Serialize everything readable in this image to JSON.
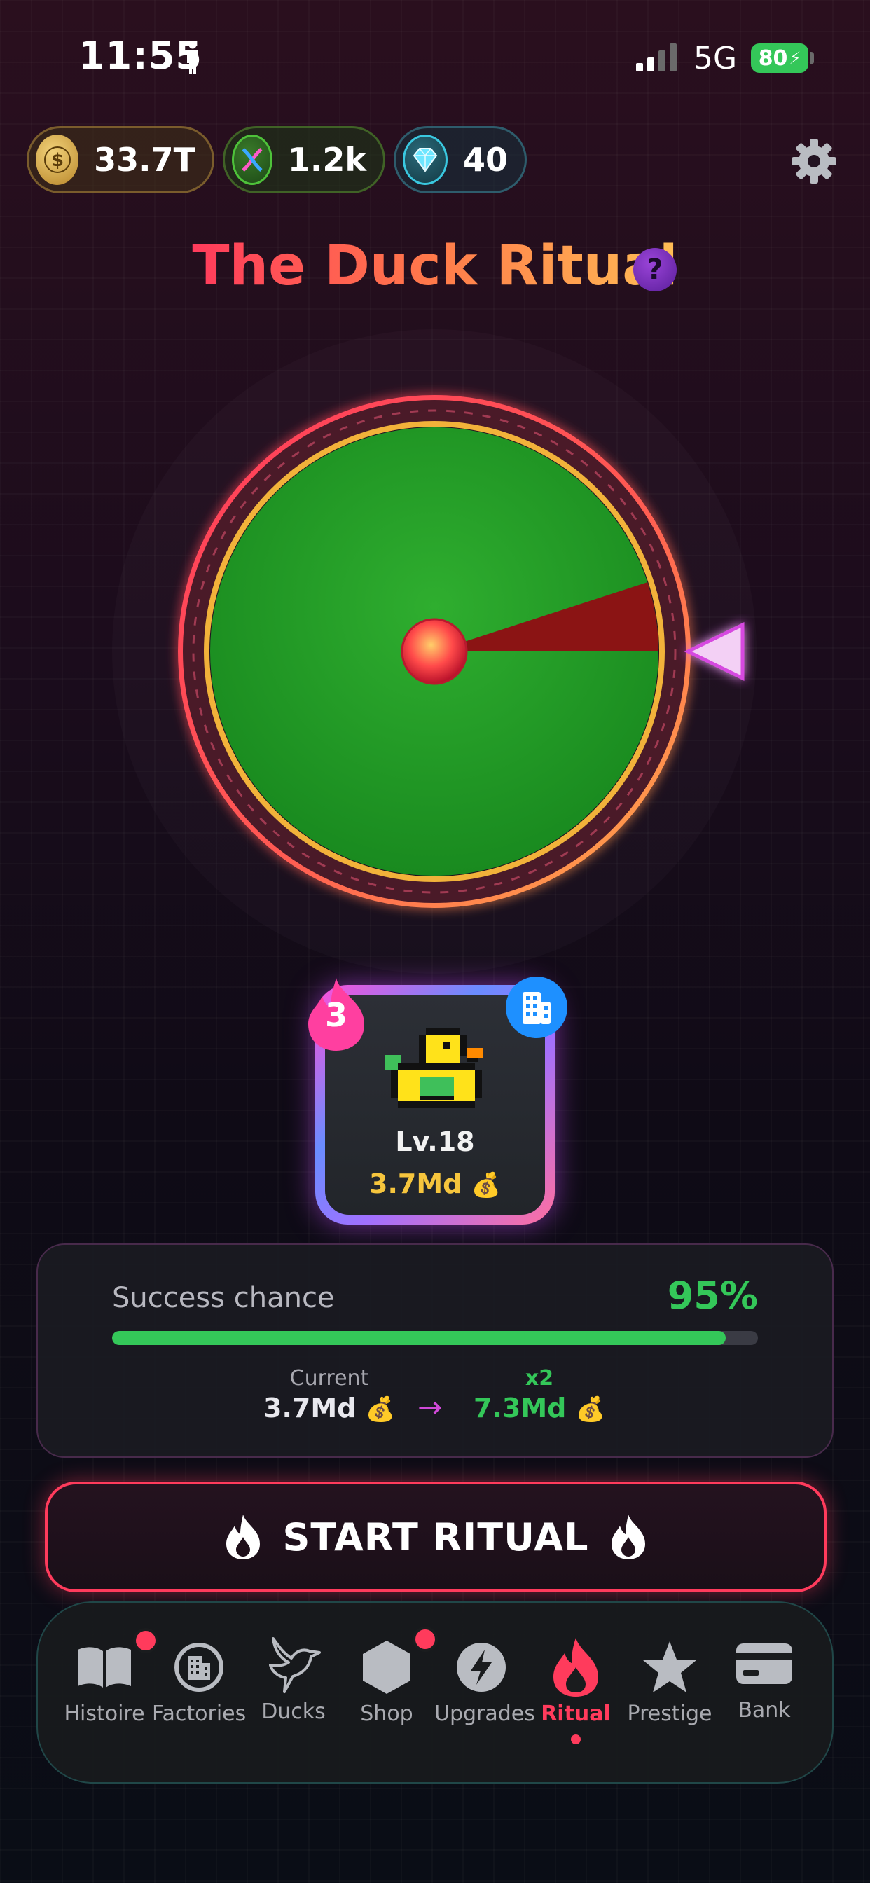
{
  "status_bar": {
    "time": "11:55",
    "network": "5G",
    "battery": "80"
  },
  "currencies": [
    {
      "name": "money",
      "value": "33.7T"
    },
    {
      "name": "dna",
      "value": "1.2k"
    },
    {
      "name": "gems",
      "value": "40"
    }
  ],
  "title": "The Duck Ritual",
  "help_icon": "?",
  "wheel": {
    "success_color": "#1f9a2a",
    "fail_color": "#8b1414",
    "fail_fraction": 0.05
  },
  "duck_card": {
    "streak": "3",
    "level": "Lv.18",
    "value": "3.7Md",
    "value_icon": "💰"
  },
  "success": {
    "label": "Success chance",
    "percent_text": "95%",
    "fraction": 0.95,
    "current_label": "Current",
    "current_value": "3.7Md",
    "multiplier": "x2",
    "new_value": "7.3Md",
    "money_icon": "💰",
    "arrow": "→"
  },
  "start_button": {
    "label": "START RITUAL"
  },
  "tabs": [
    {
      "id": "histoire",
      "label": "Histoire",
      "badge": true,
      "icon": "book-icon"
    },
    {
      "id": "factories",
      "label": "Factories",
      "badge": false,
      "icon": "factory-icon"
    },
    {
      "id": "ducks",
      "label": "Ducks",
      "badge": false,
      "icon": "bird-icon"
    },
    {
      "id": "shop",
      "label": "Shop",
      "badge": true,
      "icon": "hexagon-icon"
    },
    {
      "id": "upgrades",
      "label": "Upgrades",
      "badge": false,
      "icon": "bolt-icon"
    },
    {
      "id": "ritual",
      "label": "Ritual",
      "badge": false,
      "icon": "flame-icon",
      "active": true
    },
    {
      "id": "prestige",
      "label": "Prestige",
      "badge": false,
      "icon": "star-icon"
    },
    {
      "id": "bank",
      "label": "Bank",
      "badge": false,
      "icon": "card-icon"
    }
  ],
  "colors": {
    "accent": "#ff3b5c",
    "success": "#34c759",
    "gold": "#f6c53d"
  }
}
